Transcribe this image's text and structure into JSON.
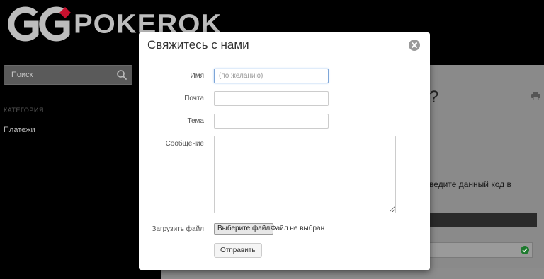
{
  "brand": {
    "logo_text": "POKEROK",
    "logo_color": "#bdbdbd"
  },
  "sidebar": {
    "search_placeholder": "Поиск",
    "category_heading": "КАТЕГОРИЯ",
    "items": [
      {
        "label": "Платежи"
      }
    ]
  },
  "background_content": {
    "question_mark": "?",
    "partial_text": "ведите данный код в"
  },
  "modal": {
    "title": "Свяжитесь с нами",
    "fields": {
      "name": {
        "label": "Имя",
        "placeholder": "(по желанию)",
        "value": ""
      },
      "email": {
        "label": "Почта",
        "value": ""
      },
      "subject": {
        "label": "Тема",
        "value": ""
      },
      "message": {
        "label": "Сообщение",
        "value": ""
      },
      "file": {
        "label": "Загрузить файл",
        "button_label": "Выберите файл",
        "status": "Файл не выбран"
      }
    },
    "submit_label": "Отправить"
  },
  "colors": {
    "page_background": "#000000",
    "panel_background": "#8a8a8a",
    "modal_background": "#ffffff",
    "focus_border": "#7ea6d8"
  }
}
